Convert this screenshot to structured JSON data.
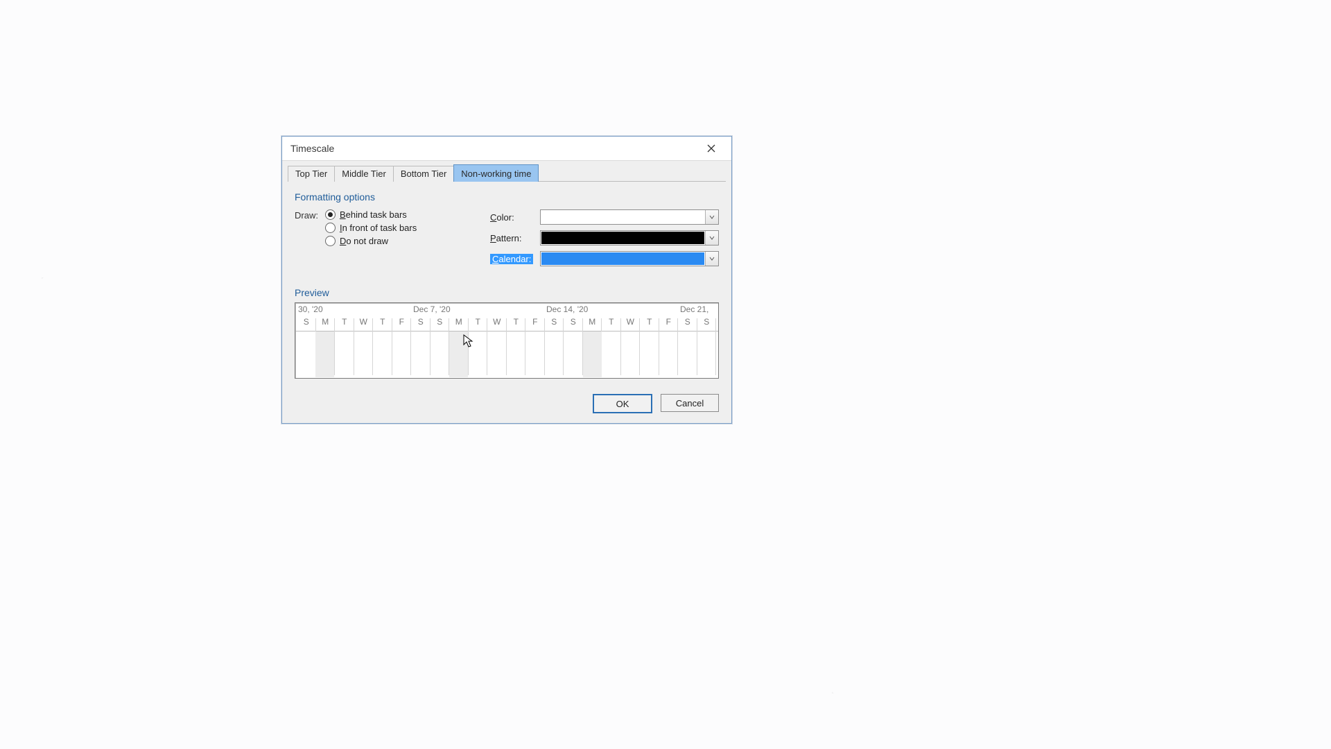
{
  "dialog": {
    "title": "Timescale"
  },
  "tabs": {
    "top": "Top Tier",
    "middle": "Middle Tier",
    "bottom": "Bottom Tier",
    "nonworking": "Non-working time"
  },
  "section": {
    "formatting_options": "Formatting options",
    "preview": "Preview"
  },
  "draw": {
    "label": "Draw:",
    "behind": "ehind task bars",
    "behind_prefix": "B",
    "infront_prefix": "I",
    "infront": "n front of task bars",
    "donot_prefix": "D",
    "donot": "o not draw"
  },
  "combos": {
    "color_label": "olor:",
    "color_prefix": "C",
    "pattern_label": "attern:",
    "pattern_prefix": "P",
    "calendar_label": "alendar:",
    "calendar_prefix": "C"
  },
  "preview": {
    "weeks": [
      "30, '20",
      "Dec 7, '20",
      "Dec 14, '20",
      "Dec 21,"
    ],
    "days": [
      "S",
      "M",
      "T",
      "W",
      "T",
      "F",
      "S",
      "S",
      "M",
      "T",
      "W",
      "T",
      "F",
      "S",
      "S",
      "M",
      "T",
      "W",
      "T",
      "F",
      "S",
      "S"
    ]
  },
  "buttons": {
    "ok": "OK",
    "cancel": "Cancel"
  }
}
